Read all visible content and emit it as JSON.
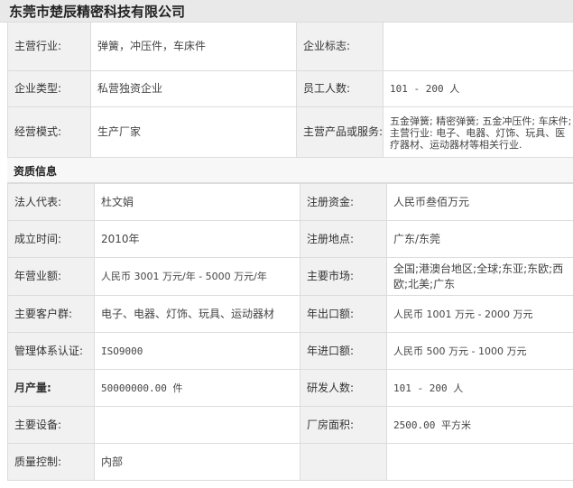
{
  "company_name": "东莞市楚辰精密科技有限公司",
  "basic": {
    "main_industry_label": "主营行业:",
    "main_industry_value": "弹簧，冲压件，车床件",
    "logo_label": "企业标志:",
    "logo_value": "",
    "company_type_label": "企业类型:",
    "company_type_value": "私营独资企业",
    "employees_label": "员工人数:",
    "employees_value": "101 - 200 人",
    "business_mode_label": "经营模式:",
    "business_mode_value": "生产厂家",
    "main_products_label": "主营产品或服务:",
    "main_products_value": "五金弹簧; 精密弹簧; 五金冲压件; 车床件; 主营行业: 电子、电器、灯饰、玩具、医疗器材、运动器材等相关行业."
  },
  "qualification": {
    "section_title": "资质信息",
    "legal_rep_label": "法人代表:",
    "legal_rep_value": "杜文娟",
    "reg_capital_label": "注册资金:",
    "reg_capital_value": "人民币叁佰万元",
    "founded_label": "成立时间:",
    "founded_value": "2010年",
    "reg_location_label": "注册地点:",
    "reg_location_value": "广东/东莞",
    "annual_revenue_label": "年营业额:",
    "annual_revenue_value": "人民币 3001 万元/年 - 5000 万元/年",
    "main_market_label": "主要市场:",
    "main_market_value": "全国;港澳台地区;全球;东亚;东欧;西欧;北美;广东",
    "main_customers_label": "主要客户群:",
    "main_customers_value": "电子、电器、灯饰、玩具、运动器材",
    "annual_export_label": "年出口额:",
    "annual_export_value": "人民币 1001 万元 - 2000 万元",
    "cert_label": "管理体系认证:",
    "cert_value": "ISO9000",
    "annual_import_label": "年进口额:",
    "annual_import_value": "人民币 500 万元 -  1000 万元",
    "monthly_output_label": "月产量:",
    "monthly_output_value": "50000000.00 件",
    "rd_staff_label": "研发人数:",
    "rd_staff_value": "101 - 200 人",
    "equipment_label": "主要设备:",
    "equipment_value": "",
    "plant_area_label": "厂房面积:",
    "plant_area_value": "2500.00 平方米",
    "quality_control_label": "质量控制:",
    "quality_control_value": "内部"
  }
}
